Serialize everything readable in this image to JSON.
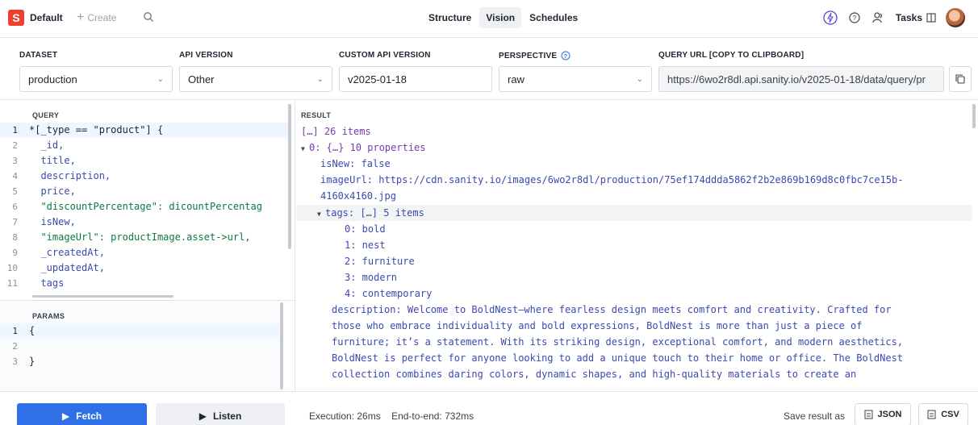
{
  "topbar": {
    "logo_letter": "S",
    "workspace": "Default",
    "create_label": "Create",
    "nav": [
      "Structure",
      "Vision",
      "Schedules"
    ],
    "active_nav": "Vision",
    "tasks_label": "Tasks"
  },
  "controls": {
    "dataset": {
      "label": "DATASET",
      "value": "production"
    },
    "api_version": {
      "label": "API VERSION",
      "value": "Other"
    },
    "custom_api_version": {
      "label": "CUSTOM API VERSION",
      "value": "v2025-01-18"
    },
    "perspective": {
      "label": "PERSPECTIVE",
      "value": "raw"
    },
    "query_url": {
      "label": "QUERY URL [COPY TO CLIPBOARD]",
      "value": "https://6wo2r8dl.api.sanity.io/v2025-01-18/data/query/pr"
    }
  },
  "query": {
    "label": "QUERY",
    "lines": [
      {
        "n": "1",
        "text": "*[_type == \"product\"] {"
      },
      {
        "n": "2",
        "text": "  _id,"
      },
      {
        "n": "3",
        "text": "  title,"
      },
      {
        "n": "4",
        "text": "  description,"
      },
      {
        "n": "5",
        "text": "  price,"
      },
      {
        "n": "6",
        "text": "  \"discountPercentage\": dicountPercentag"
      },
      {
        "n": "7",
        "text": "  isNew,"
      },
      {
        "n": "8",
        "text": "  \"imageUrl\": productImage.asset->url,"
      },
      {
        "n": "9",
        "text": "  _createdAt,"
      },
      {
        "n": "10",
        "text": "  _updatedAt,"
      },
      {
        "n": "11",
        "text": "  tags"
      }
    ]
  },
  "params": {
    "label": "PARAMS",
    "lines": [
      {
        "n": "1",
        "text": "{"
      },
      {
        "n": "2",
        "text": ""
      },
      {
        "n": "3",
        "text": "}"
      }
    ]
  },
  "result": {
    "label": "RESULT",
    "count_line": "[…] 26 items",
    "item0": "0: {…} 10 properties",
    "isNew": "isNew: false",
    "imageUrl_1": "imageUrl: https://cdn.sanity.io/images/6wo2r8dl/production/75ef174ddda5862f2b2e869b169d8c0fbc7ce15b-",
    "imageUrl_2": "4160x4160.jpg",
    "tags_header": "tags: […] 5 items",
    "tags": [
      "0: bold",
      "1: nest",
      "2: furniture",
      "3: modern",
      "4: contemporary"
    ],
    "description_lines": [
      "description: Welcome to BoldNest—where fearless design meets comfort and creativity. Crafted for",
      "those who embrace individuality and bold expressions, BoldNest is more than just a piece of",
      "furniture; it’s a statement. With its striking design, exceptional comfort, and modern aesthetics,",
      "BoldNest is perfect for anyone looking to add a unique touch to their home or office. The BoldNest",
      "collection combines daring colors, dynamic shapes, and high-quality materials to create an"
    ]
  },
  "footer": {
    "fetch_label": "Fetch",
    "listen_label": "Listen",
    "execution": "Execution: 26ms",
    "end_to_end": "End-to-end: 732ms",
    "save_as": "Save result as",
    "json_label": "JSON",
    "csv_label": "CSV"
  }
}
